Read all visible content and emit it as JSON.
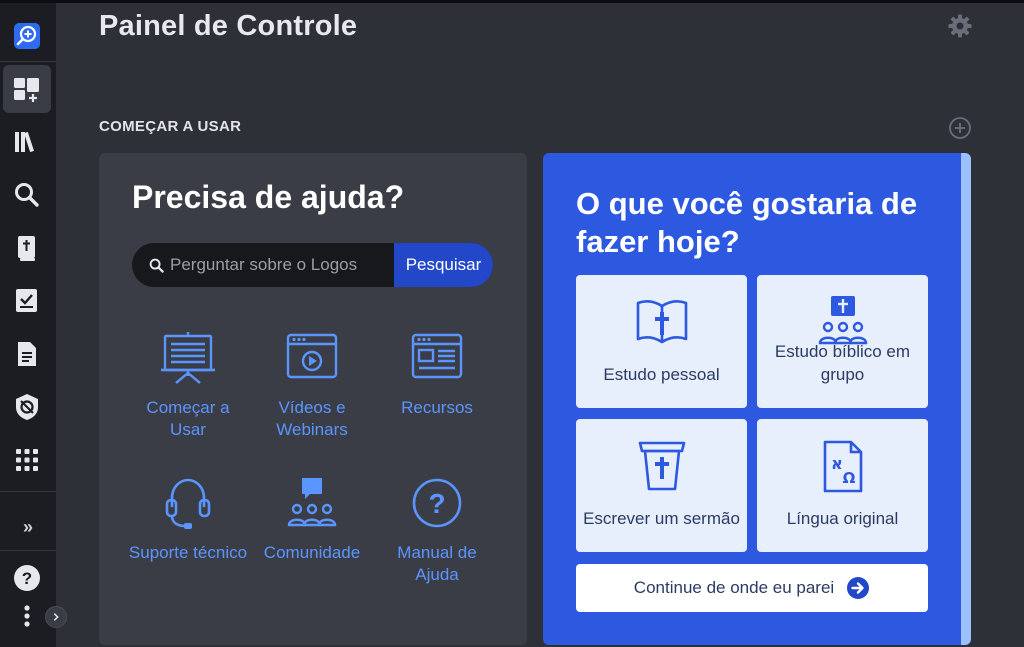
{
  "page": {
    "title": "Painel de Controle"
  },
  "section": {
    "title": "COMEÇAR A USAR"
  },
  "help": {
    "title": "Precisa de ajuda?",
    "search_placeholder": "Perguntar sobre o Logos",
    "search_button": "Pesquisar",
    "links": [
      {
        "label": "Começar a Usar",
        "icon": "presentation-board-icon"
      },
      {
        "label": "Vídeos e Webinars",
        "icon": "video-window-icon"
      },
      {
        "label": "Recursos",
        "icon": "browser-window-icon"
      },
      {
        "label": "Suporte técnico",
        "icon": "headset-icon"
      },
      {
        "label": "Comunidade",
        "icon": "community-chat-icon"
      },
      {
        "label": "Manual de Ajuda",
        "icon": "question-circle-icon"
      }
    ]
  },
  "todo": {
    "title": "O que você gostaria de fazer hoje?",
    "tiles": [
      {
        "label": "Estudo pessoal",
        "icon": "open-bible-icon"
      },
      {
        "label": "Estudo bíblico em grupo",
        "icon": "group-study-icon"
      },
      {
        "label": "Escrever um sermão",
        "icon": "pulpit-icon"
      },
      {
        "label": "Língua original",
        "icon": "hebrew-greek-document-icon"
      }
    ],
    "continue_button": "Continue de onde eu parei"
  },
  "sidebar": {
    "items": [
      {
        "name": "logos-search-icon"
      },
      {
        "name": "dashboard-icon"
      },
      {
        "name": "library-icon"
      },
      {
        "name": "search-icon"
      },
      {
        "name": "bible-icon"
      },
      {
        "name": "reading-plan-icon"
      },
      {
        "name": "document-icon"
      },
      {
        "name": "guide-icon"
      },
      {
        "name": "apps-grid-icon"
      }
    ],
    "collapse_glyph": "»"
  },
  "colors": {
    "background": "#2e3038",
    "sidebar": "#1c1d22",
    "card": "#3b3d46",
    "accent_blue": "#2d58e0",
    "link_blue": "#5b95ff",
    "tile": "#e7eefc"
  }
}
